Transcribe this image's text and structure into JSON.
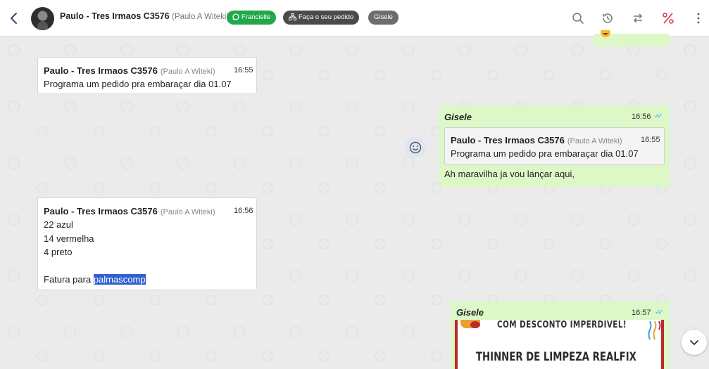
{
  "header": {
    "contact_name": "Paulo - Tres Irmaos C3576",
    "contact_sub": "(Paulo A Witeki)",
    "tags": [
      {
        "label": "Francielle",
        "color": "#21a84a"
      },
      {
        "label": "Faça o seu pedido",
        "color": "#4a4a4a"
      },
      {
        "label": "Gisele",
        "color": "#6d6d6d"
      }
    ]
  },
  "messages": {
    "m1": {
      "sender": "Paulo - Tres Irmaos C3576",
      "sender_sub": "(Paulo A Witeki)",
      "time": "16:55",
      "text": "Programa um pedido pra embaraçar dia 01.07"
    },
    "m2": {
      "sender": "Gisele",
      "time": "16:56",
      "quote_sender": "Paulo - Tres Irmaos C3576",
      "quote_sender_sub": "(Paulo A Witeki)",
      "quote_time": "16:55",
      "quote_text": "Programa um pedido pra embaraçar dia 01.07",
      "text": "Ah maravilha ja vou lançar aqui,"
    },
    "m3": {
      "sender": "Paulo - Tres Irmaos C3576",
      "sender_sub": "(Paulo A Witeki)",
      "time": "16:56",
      "lines": [
        "22 azul",
        "14 vermelha",
        "4 preto"
      ],
      "fatura_prefix": "Fatura para ",
      "fatura_selected": "palmascomp"
    },
    "m4": {
      "sender": "Gisele",
      "time": "16:57",
      "image_line1": "COM DESCONTO IMPERDÍVEL!",
      "image_line2": "THINNER DE LIMPEZA REALFIX"
    }
  },
  "colors": {
    "outgoing_bubble": "#dcf8c6",
    "read_ticks": "#4fa3f7",
    "selection": "#2f5fd2"
  },
  "icons": [
    "back-arrow-icon",
    "whatsapp-icon",
    "sitemap-icon",
    "search-icon",
    "history-icon",
    "transfer-icon",
    "percent-icon",
    "kebab-menu-icon",
    "smiley-icon",
    "chevron-down-icon"
  ]
}
